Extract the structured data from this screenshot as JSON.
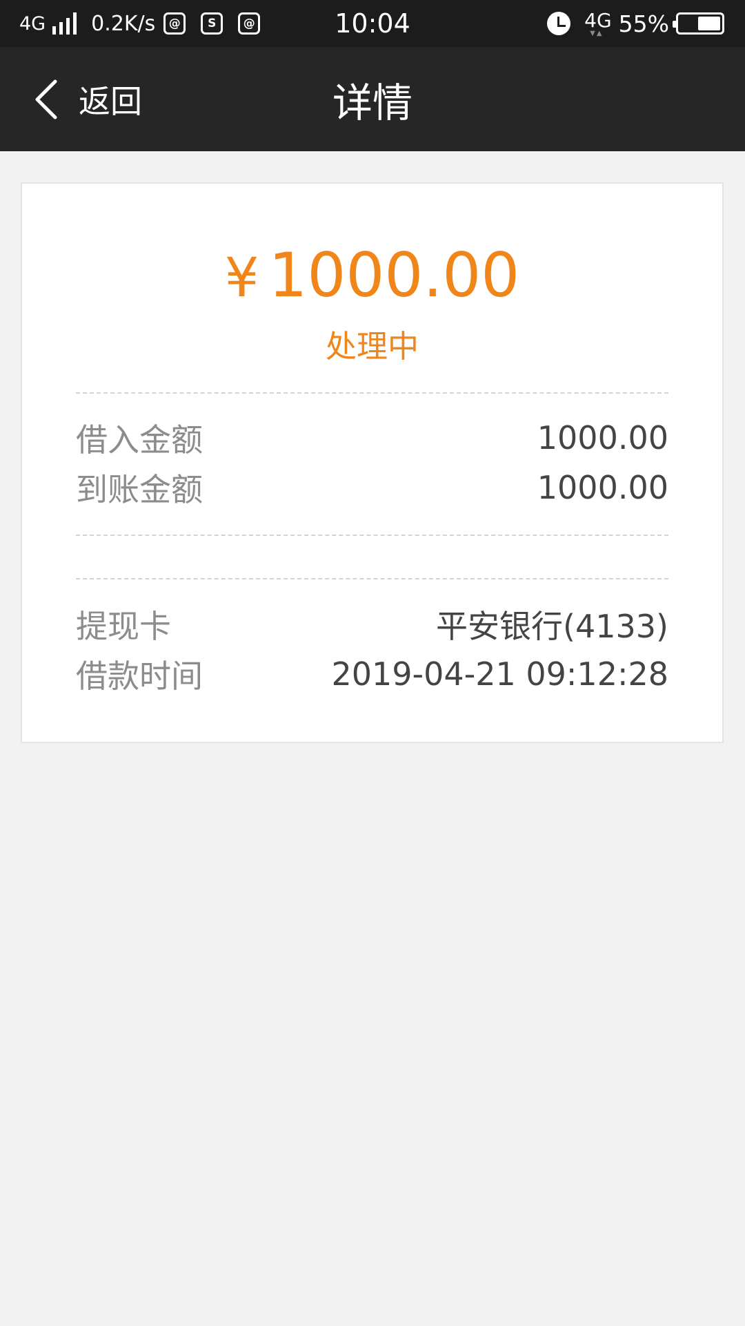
{
  "status_bar": {
    "network": "4G",
    "speed": "0.2K/s",
    "time": "10:04",
    "network_right": "4G",
    "battery_percent": "55%",
    "battery_level": 0.55
  },
  "nav": {
    "back_label": "返回",
    "title": "详情"
  },
  "detail": {
    "currency_symbol": "¥",
    "amount": "1000.00",
    "status": "处理中",
    "rows_top": [
      {
        "label": "借入金额",
        "value": "1000.00"
      },
      {
        "label": "到账金额",
        "value": "1000.00"
      }
    ],
    "rows_bottom": [
      {
        "label": "提现卡",
        "value": "平安银行(4133)"
      },
      {
        "label": "借款时间",
        "value": "2019-04-21 09:12:28"
      }
    ]
  },
  "colors": {
    "accent": "#f08519",
    "nav_bg": "#262626",
    "status_bar_bg": "#1c1c1c",
    "page_bg": "#f2f2f2"
  }
}
